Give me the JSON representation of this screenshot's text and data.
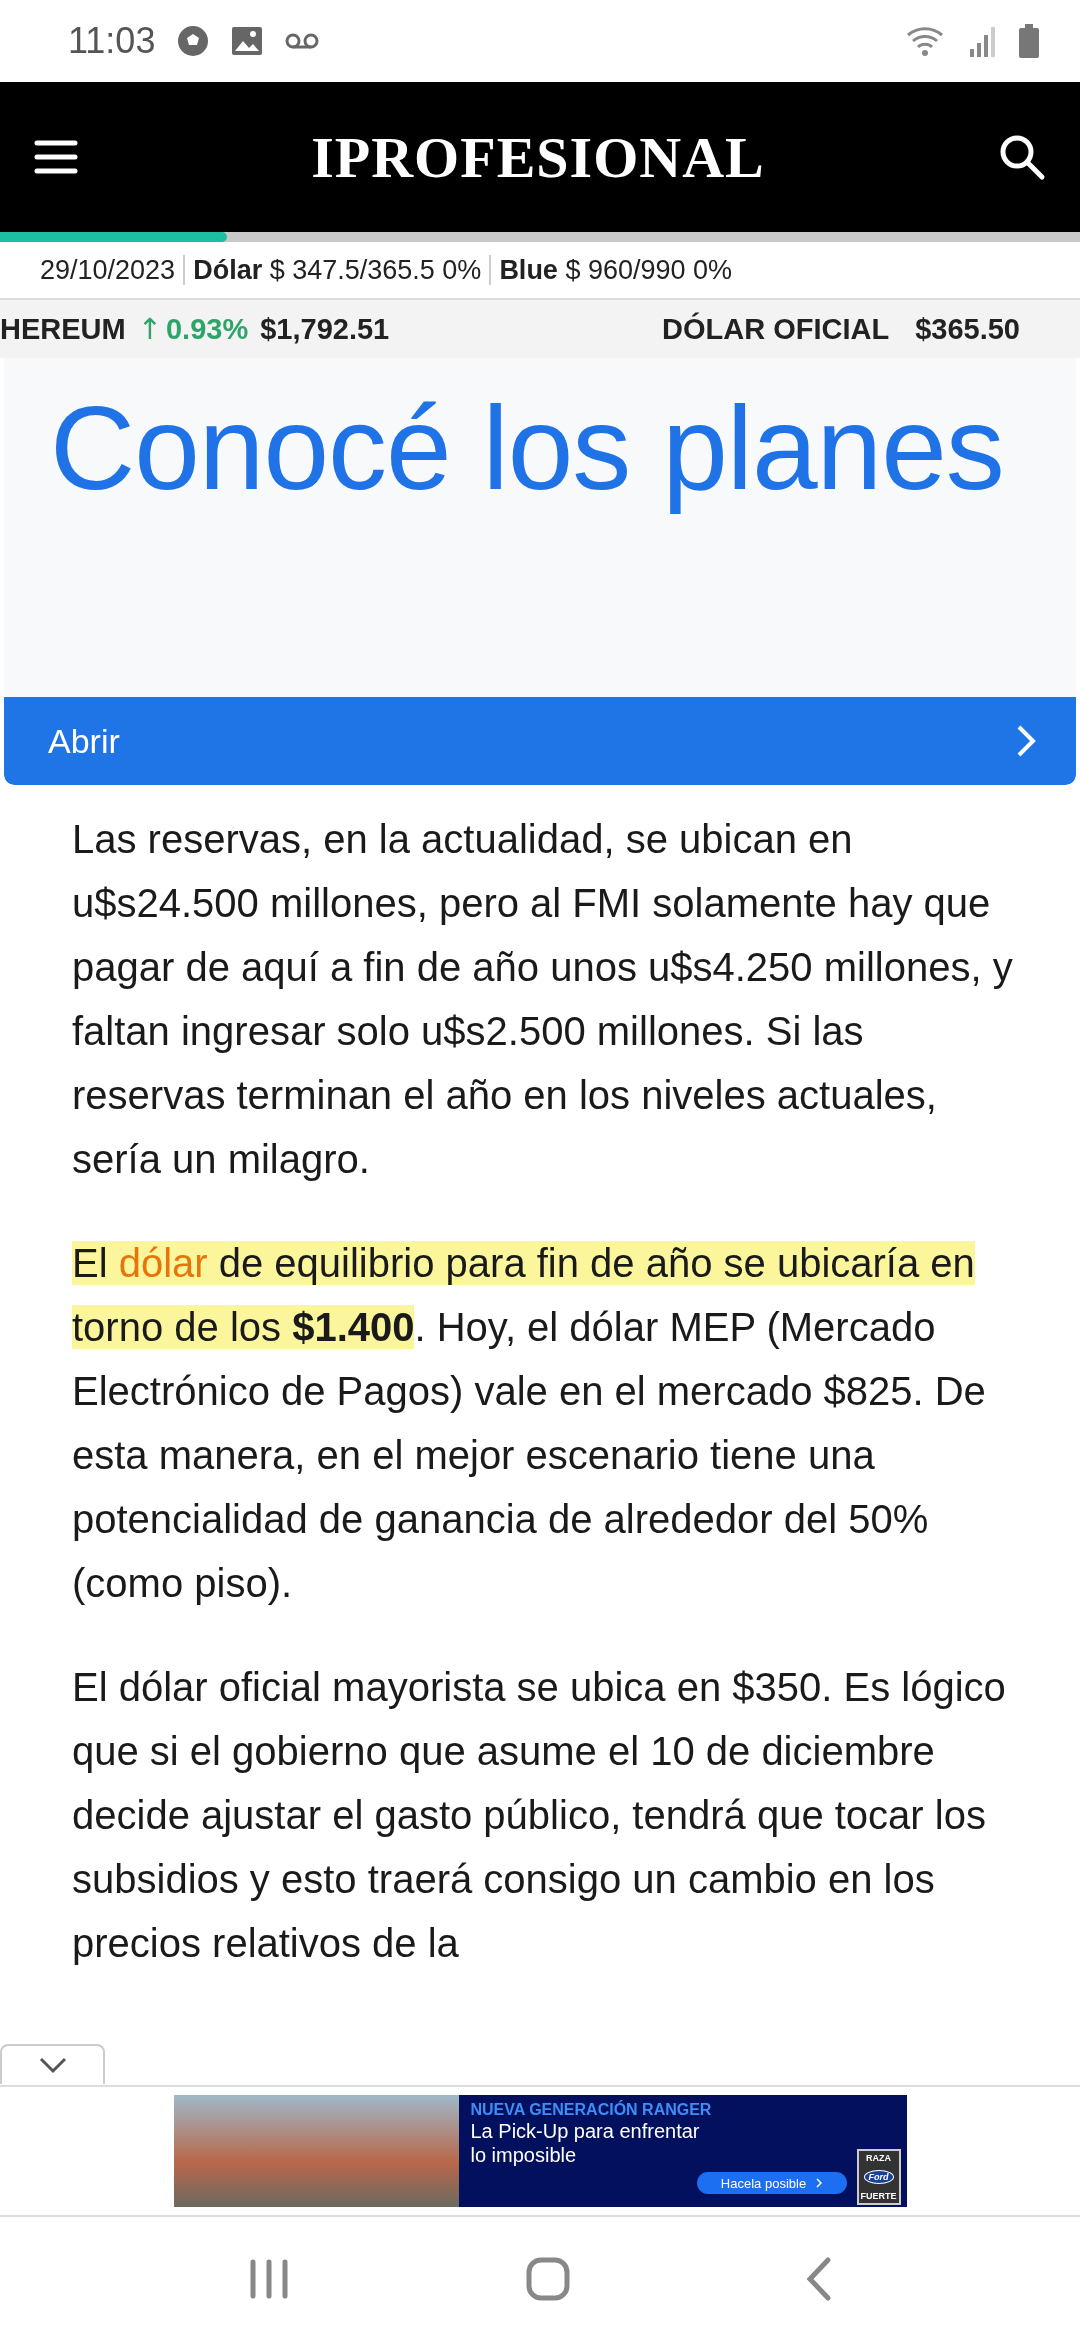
{
  "status_bar": {
    "time": "11:03"
  },
  "header": {
    "logo": "IPROFESIONAL"
  },
  "reading_progress": {
    "level": 0.21
  },
  "quotes_bar": {
    "date": "29/10/2023",
    "quotes": [
      {
        "label": "Dólar",
        "value": "$ 347.5/365.5 0%"
      },
      {
        "label": "Blue",
        "value": "$ 960/990 0%"
      }
    ]
  },
  "ticker": [
    {
      "name": "HEREUM",
      "arrow": "↑",
      "change": "0.93%",
      "price": "$1,792.51"
    },
    {
      "name": "DÓLAR OFICIAL",
      "price": "$365.50"
    }
  ],
  "promo": {
    "headline": "Conocé los planes",
    "action": "Abrir"
  },
  "article": {
    "paragraphs": [
      [
        {
          "kind": "plain",
          "text": "Las reservas, en la actualidad, se ubican en u$s24.500 millones, pero al FMI solamente hay que pagar de aquí a fin de año unos u$s4.250 millones, y faltan ingresar solo u$s2.500 millones. Si las reservas terminan el año en los niveles actuales, sería un milagro."
        }
      ],
      [
        {
          "kind": "highlight",
          "text": "El "
        },
        {
          "kind": "link",
          "text": "dólar"
        },
        {
          "kind": "highlight",
          "text": " de equilibrio para fin de año se ubicaría en torno de los "
        },
        {
          "kind": "highlight-bold",
          "text": "$1.400"
        },
        {
          "kind": "plain",
          "text": ". Hoy, el dólar MEP (Mercado Electrónico de Pagos) vale en el mercado $825. De esta manera, en el mejor escenario tiene una potencialidad de ganancia de alrededor del 50% (como piso)."
        }
      ],
      [
        {
          "kind": "plain",
          "text": "El dólar oficial mayorista se ubica en $350. Es lógico que si el gobierno que asume el 10 de diciembre decide ajustar el gasto público, tendrá que tocar los subsidios y esto traerá consigo un cambio en los precios relativos de la"
        }
      ]
    ]
  },
  "bottom_ad": {
    "kicker": "NUEVA GENERACIÓN RANGER",
    "lines": [
      "La Pick-Up para enfrentar",
      "lo imposible"
    ],
    "button": "Hacela posible",
    "badge_top": "RAZA",
    "badge_logo": "Ford",
    "badge_bottom": "FUERTE"
  }
}
